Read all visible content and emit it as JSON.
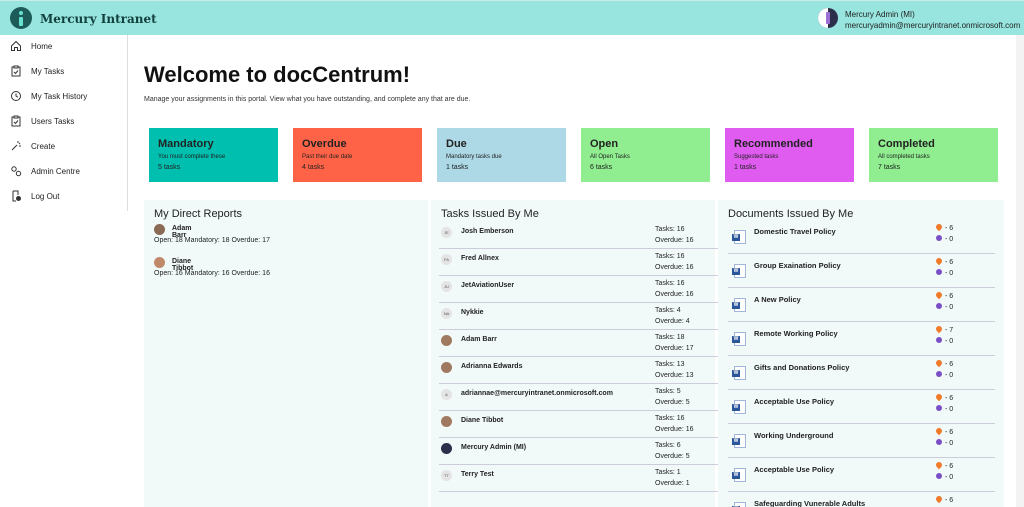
{
  "app": {
    "title": "Mercury Intranet"
  },
  "user": {
    "name": "Mercury Admin (MI)",
    "email": "mercuryadmin@mercuryintranet.onmicrosoft.com"
  },
  "sidebar": {
    "items": [
      {
        "label": "Home",
        "icon": "home-icon"
      },
      {
        "label": "My Tasks",
        "icon": "clipboard-check-icon"
      },
      {
        "label": "My Task History",
        "icon": "history-icon"
      },
      {
        "label": "Users Tasks",
        "icon": "clipboard-icon"
      },
      {
        "label": "Create",
        "icon": "sparkle-icon"
      },
      {
        "label": "Admin Centre",
        "icon": "settings-icon"
      },
      {
        "label": "Log Out",
        "icon": "logout-icon"
      }
    ]
  },
  "header": {
    "title": "Welcome to docCentrum!",
    "subtitle": "Manage your assignments in this portal. View what you have outstanding, and complete any that are due."
  },
  "cards": [
    {
      "title": "Mandatory",
      "desc": "You must complete these",
      "count": "5 tasks",
      "color": "#00bfae"
    },
    {
      "title": "Overdue",
      "desc": "Past their due date",
      "count": "4 tasks",
      "color": "#ff6347"
    },
    {
      "title": "Due",
      "desc": "Mandatory tasks due",
      "count": "1 tasks",
      "color": "#add8e6"
    },
    {
      "title": "Open",
      "desc": "All Open Tasks",
      "count": "6 tasks",
      "color": "#90ee90"
    },
    {
      "title": "Recommended",
      "desc": "Suggested tasks",
      "count": "1 tasks",
      "color": "#e05cf0"
    },
    {
      "title": "Completed",
      "desc": "All completed tasks",
      "count": "7 tasks",
      "color": "#90ee90"
    }
  ],
  "direct_reports": {
    "title": "My Direct Reports",
    "items": [
      {
        "name": "Adam Barr",
        "stats": "Open: 18 Mandatory: 18 Overdue: 17"
      },
      {
        "name": "Diane Tibbot",
        "stats": "Open: 16 Mandatory: 16 Overdue: 16"
      }
    ]
  },
  "tasks_issued": {
    "title": "Tasks Issued By Me",
    "items": [
      {
        "initials": "JE",
        "name": "Josh Emberson",
        "tasks": "Tasks: 16",
        "overdue": "Overdue: 16"
      },
      {
        "initials": "FA",
        "name": "Fred Allnex",
        "tasks": "Tasks: 16",
        "overdue": "Overdue: 16"
      },
      {
        "initials": "JU",
        "name": "JetAviationUser",
        "tasks": "Tasks: 16",
        "overdue": "Overdue: 16"
      },
      {
        "initials": "NA",
        "name": "Nykkie",
        "tasks": "Tasks: 4",
        "overdue": "Overdue: 4"
      },
      {
        "initials": "",
        "name": "Adam Barr",
        "tasks": "Tasks: 18",
        "overdue": "Overdue: 17"
      },
      {
        "initials": "",
        "name": "Adrianna Edwards",
        "tasks": "Tasks: 13",
        "overdue": "Overdue: 13"
      },
      {
        "initials": "A",
        "name": "adriannae@mercuryintranet.onmicrosoft.com",
        "tasks": "Tasks: 5",
        "overdue": "Overdue: 5"
      },
      {
        "initials": "",
        "name": "Diane Tibbot",
        "tasks": "Tasks: 16",
        "overdue": "Overdue: 16"
      },
      {
        "initials": "",
        "name": "Mercury Admin (MI)",
        "tasks": "Tasks: 6",
        "overdue": "Overdue: 5"
      },
      {
        "initials": "TT",
        "name": "Terry Test",
        "tasks": "Tasks: 1",
        "overdue": "Overdue: 1"
      }
    ]
  },
  "documents_issued": {
    "title": "Documents Issued By Me",
    "items": [
      {
        "name": "Domestic Travel Policy",
        "a": "- 6",
        "b": "- 0"
      },
      {
        "name": "Group Exaination Policy",
        "a": "- 6",
        "b": "- 0"
      },
      {
        "name": "A New Policy",
        "a": "- 6",
        "b": "- 0"
      },
      {
        "name": "Remote Working Policy",
        "a": "- 7",
        "b": "- 0"
      },
      {
        "name": "Gifts and Donations Policy",
        "a": "- 6",
        "b": "- 0"
      },
      {
        "name": "Acceptable Use Policy",
        "a": "- 6",
        "b": "- 0"
      },
      {
        "name": "Working Underground",
        "a": "- 6",
        "b": "- 0"
      },
      {
        "name": "Acceptable Use Policy",
        "a": "- 6",
        "b": "- 0"
      },
      {
        "name": "Safeguarding Vunerable Adults",
        "a": "- 6",
        "b": ""
      }
    ]
  }
}
